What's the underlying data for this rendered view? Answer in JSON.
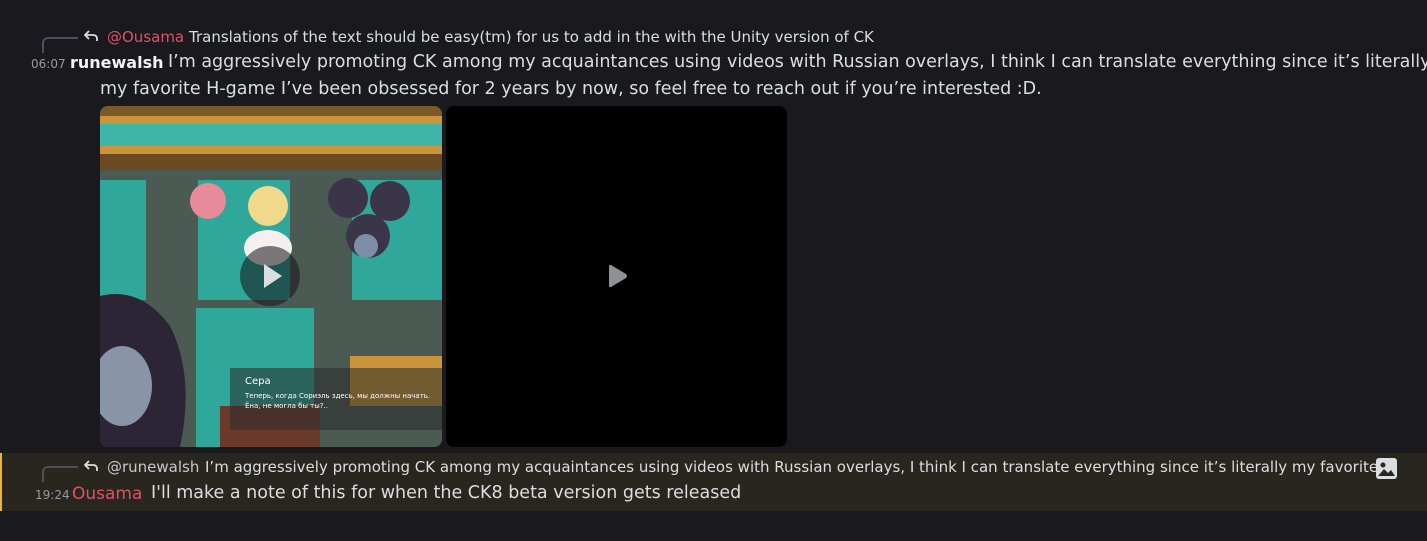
{
  "messages": [
    {
      "reply": {
        "author": "@Ousama",
        "text": "Translations of the text should be easy(tm) for us to add in the with the Unity version of CK"
      },
      "time": "06:07",
      "author": "runewalsh",
      "content_lines": [
        "I’m aggressively promoting CK among my acquaintances using videos with Russian overlays, I think I can translate everything since it’s literally",
        "my favorite H-game I’ve been obsessed for 2 years by now, so feel free to reach out if you’re interested :D."
      ],
      "attachments": [
        {
          "kind": "video",
          "subtitle_speaker": "Сера",
          "subtitle_line1": "Теперь, когда Сориэль здесь, мы должны начать.",
          "subtitle_line2": "Ёна, не могла бы ты?.."
        },
        {
          "kind": "video"
        }
      ]
    },
    {
      "reply": {
        "author": "@runewalsh",
        "text": "I’m aggressively promoting CK among my acquaintances using videos with Russian overlays, I think I can translate everything since it’s literally my favorite ..."
      },
      "time": "19:24",
      "author": "Ousama",
      "content": "I'll make a note of this for when the CK8 beta version gets released"
    }
  ],
  "colors": {
    "background": "#1a1a1e",
    "highlight_bg": "#29251f",
    "highlight_border": "#f0b232",
    "ousama_color": "#e0506a",
    "runewalsh_color": "#f2f3f5",
    "muted": "#949ba4"
  },
  "icons": [
    "reply-arrow-icon",
    "play-icon",
    "image-icon"
  ]
}
